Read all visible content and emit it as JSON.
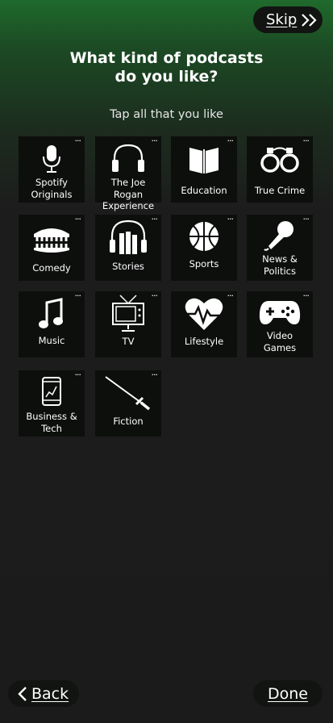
{
  "header": {
    "skip_label": "Skip"
  },
  "title": {
    "line1": "What kind of podcasts",
    "line2": "do you like?"
  },
  "subtitle": "Tap all that you like",
  "categories": [
    {
      "label": "Spotify Originals",
      "line1": "Spotify",
      "line2": "Originals",
      "icon": "microphone-icon"
    },
    {
      "label": "The Joe Rogan Experience",
      "line1": "The Joe Rogan",
      "line2": "Experience",
      "icon": "headphones-icon"
    },
    {
      "label": "Education",
      "line1": "Education",
      "line2": "",
      "icon": "open-book-icon"
    },
    {
      "label": "True Crime",
      "line1": "True Crime",
      "line2": "",
      "icon": "handcuffs-icon"
    },
    {
      "label": "Comedy",
      "line1": "Comedy",
      "line2": "",
      "icon": "chattering-teeth-icon"
    },
    {
      "label": "Stories",
      "line1": "Stories",
      "line2": "",
      "icon": "books-headphones-icon"
    },
    {
      "label": "Sports",
      "line1": "Sports",
      "line2": "",
      "icon": "basketball-icon"
    },
    {
      "label": "News & Politics",
      "line1": "News &",
      "line2": "Politics",
      "icon": "press-microphone-icon"
    },
    {
      "label": "Music",
      "line1": "Music",
      "line2": "",
      "icon": "music-note-icon"
    },
    {
      "label": "TV",
      "line1": "TV",
      "line2": "",
      "icon": "television-icon"
    },
    {
      "label": "Lifestyle",
      "line1": "Lifestyle",
      "line2": "",
      "icon": "heartbeat-icon"
    },
    {
      "label": "Video Games",
      "line1": "Video",
      "line2": "Games",
      "icon": "gamepad-icon"
    },
    {
      "label": "Business & Tech",
      "line1": "Business &",
      "line2": "Tech",
      "icon": "tablet-chart-icon"
    },
    {
      "label": "Fiction",
      "line1": "Fiction",
      "line2": "",
      "icon": "sword-icon"
    }
  ],
  "more_glyph": "···",
  "footer": {
    "back_label": "Back",
    "done_label": "Done"
  }
}
